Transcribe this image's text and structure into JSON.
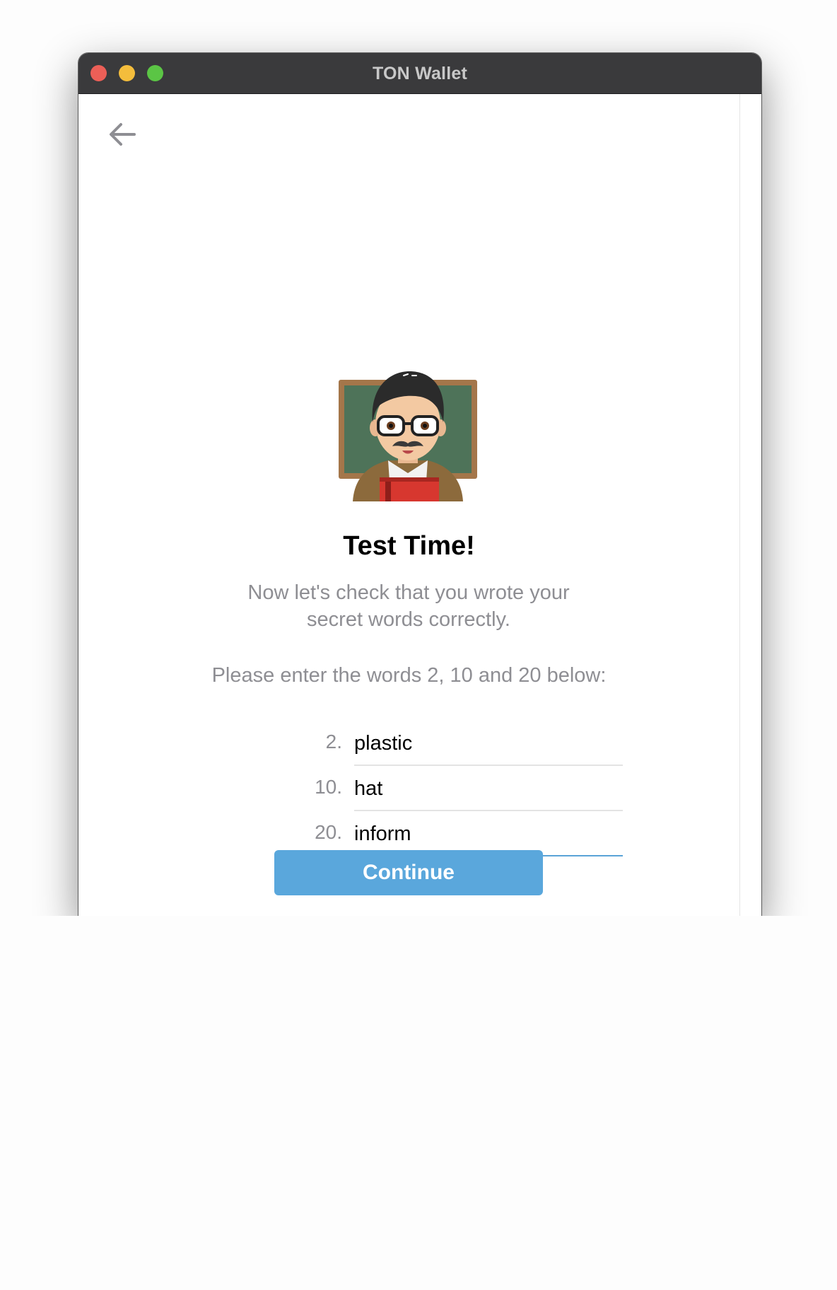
{
  "window": {
    "title": "TON Wallet"
  },
  "nav": {
    "back_icon": "arrow-left-icon"
  },
  "illustration": {
    "icon": "teacher-emoji-icon"
  },
  "main": {
    "heading": "Test Time!",
    "subtitle": "Now let's check that you wrote your secret words correctly.",
    "prompt": "Please enter the words 2, 10 and 20 below:"
  },
  "words": [
    {
      "number": "2.",
      "value": "plastic"
    },
    {
      "number": "10.",
      "value": "hat"
    },
    {
      "number": "20.",
      "value": "inform"
    }
  ],
  "actions": {
    "continue_label": "Continue"
  },
  "colors": {
    "titlebar": "#3a3a3c",
    "accent": "#5aa7dc",
    "active_underline": "#5aa3d7",
    "muted_text": "#8e8e93"
  }
}
